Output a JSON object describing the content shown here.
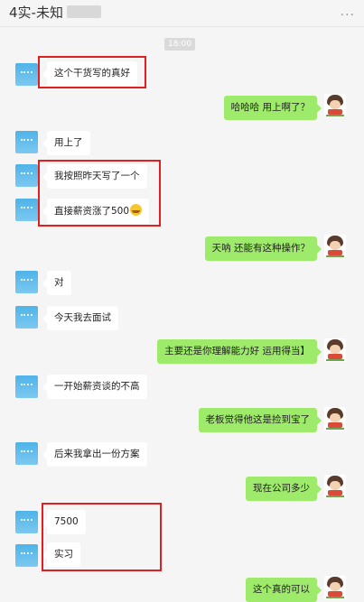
{
  "header": {
    "title": "4实-未知",
    "more": "..."
  },
  "time": "18:00",
  "messages": [
    {
      "side": "left",
      "text": "这个干货写的真好"
    },
    {
      "side": "right",
      "text": "哈哈哈    用上啊了？"
    },
    {
      "side": "left",
      "text": "用上了"
    },
    {
      "side": "left",
      "text": "我按照昨天写了一个"
    },
    {
      "side": "left",
      "text": "直接薪资涨了500",
      "emoji": "laugh-cry-emoji"
    },
    {
      "side": "right",
      "text": "天呐   还能有这种操作？"
    },
    {
      "side": "left",
      "text": "对"
    },
    {
      "side": "left",
      "text": "今天我去面试"
    },
    {
      "side": "right",
      "text": "主要还是你理解能力好    运用得当】"
    },
    {
      "side": "left",
      "text": "一开始薪资谈的不高"
    },
    {
      "side": "right",
      "text": "老板觉得他这是捡到宝了"
    },
    {
      "side": "left",
      "text": "后来我拿出一份方案"
    },
    {
      "side": "right",
      "text": "现在公司多少"
    },
    {
      "side": "left",
      "text": "7500"
    },
    {
      "side": "left",
      "text": "实习"
    },
    {
      "side": "right",
      "text": "这个真的可以"
    }
  ],
  "colors": {
    "right_bubble": "#9eea6a",
    "highlight_box": "#e02020"
  }
}
